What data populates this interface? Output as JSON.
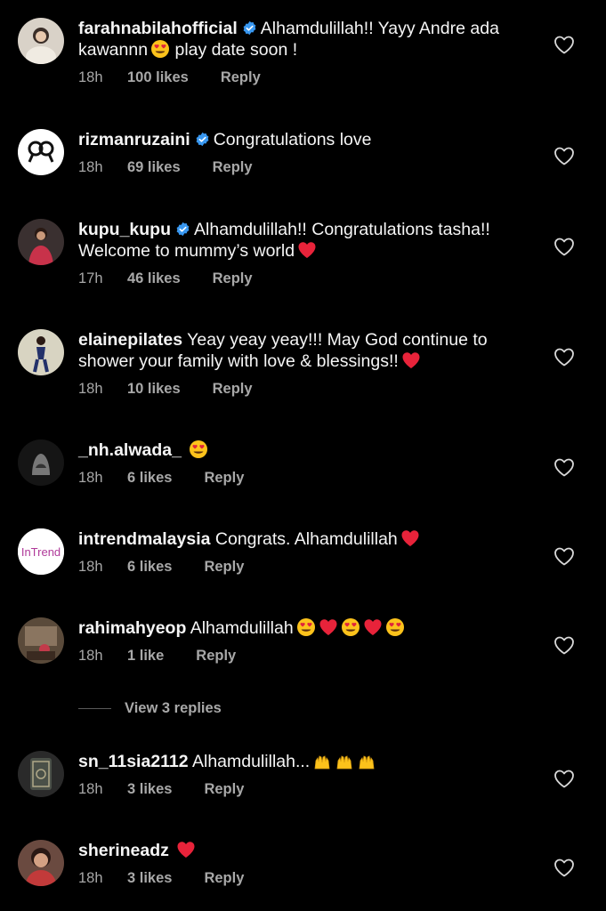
{
  "comments": [
    {
      "username": "farahnabilahofficial",
      "verified": true,
      "text": "Alhamdulillah!! Yayy Andre ada kawannn",
      "text_after": " play date soon !",
      "emoji": "heart-eyes",
      "time": "18h",
      "likes": "100 likes",
      "reply": "Reply",
      "avatar_color": "#d9d2c8"
    },
    {
      "username": "rizmanruzaini",
      "verified": true,
      "text": "Congratulations love",
      "time": "18h",
      "likes": "69 likes",
      "reply": "Reply",
      "avatar_color": "#ffffff"
    },
    {
      "username": "kupu_kupu",
      "verified": true,
      "text": "Alhamdulillah!! Congratulations tasha!! Welcome to mummy’s world",
      "emoji": "red-heart",
      "time": "17h",
      "likes": "46 likes",
      "reply": "Reply",
      "avatar_color": "#c8324a"
    },
    {
      "username": "elainepilates",
      "verified": false,
      "text": "Yeay yeay yeay!!! May God continue to shower your family with love & blessings!!",
      "emoji": "red-heart",
      "time": "18h",
      "likes": "10 likes",
      "reply": "Reply",
      "avatar_color": "#d8d4c2"
    },
    {
      "username": "_nh.alwada_",
      "verified": false,
      "text": "",
      "emoji": "heart-eyes",
      "time": "18h",
      "likes": "6 likes",
      "reply": "Reply",
      "avatar_color": "#1a1a1a"
    },
    {
      "username": "intrendmalaysia",
      "verified": false,
      "text": "Congrats. Alhamdulillah",
      "emoji": "red-heart",
      "time": "18h",
      "likes": "6 likes",
      "reply": "Reply",
      "avatar_color": "#ffffff",
      "avatar_text": "InTrend"
    },
    {
      "username": "rahimahyeop",
      "verified": false,
      "text": "Alhamdulillah",
      "emoji_sequence": [
        "heart-eyes",
        "red-heart",
        "heart-eyes",
        "red-heart",
        "heart-eyes"
      ],
      "time": "18h",
      "likes": "1 like",
      "reply": "Reply",
      "avatar_color": "#5a4a3a"
    },
    {
      "username": "sn_11sia2112",
      "verified": false,
      "text": "Alhamdulillah...",
      "emoji_sequence": [
        "raising-hands",
        "raising-hands",
        "raising-hands"
      ],
      "time": "18h",
      "likes": "3 likes",
      "reply": "Reply",
      "avatar_color": "#2a2a2a"
    },
    {
      "username": "sherineadz",
      "verified": false,
      "text": "",
      "emoji": "red-heart",
      "time": "18h",
      "likes": "3 likes",
      "reply": "Reply",
      "avatar_color": "#c23a3a"
    }
  ],
  "view_replies": "View 3 replies",
  "colors": {
    "background": "#000000",
    "text": "#f5f5f5",
    "meta": "#a8a8a8",
    "verified": "#3897f0",
    "heart": "#e8233a"
  }
}
